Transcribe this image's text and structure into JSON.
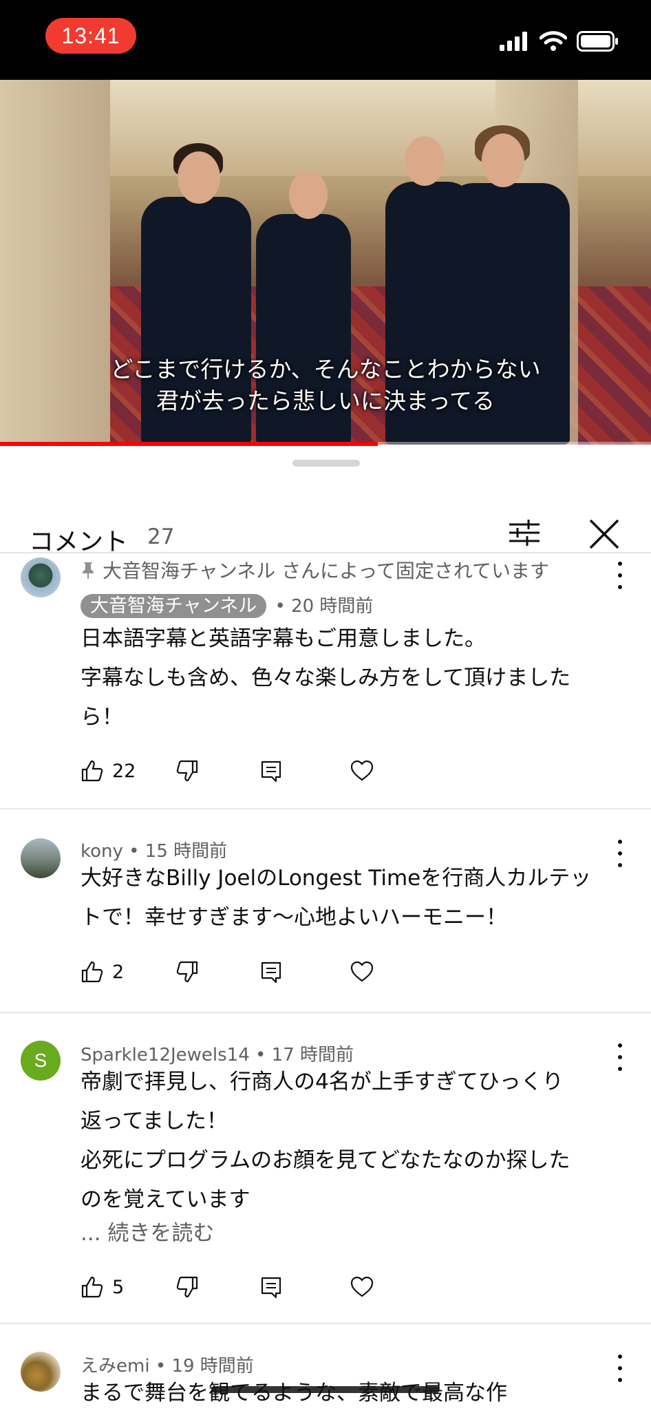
{
  "status_bar": {
    "time": "13:41"
  },
  "video": {
    "subtitle_line1": "どこまで行けるか、そんなことわからない",
    "subtitle_line2": "君が去ったら悲しいに決まってる",
    "progress": 0.58
  },
  "comments_panel": {
    "title": "コメント",
    "count": "27",
    "comments": [
      {
        "pinned_text": "大音智海チャンネル さんによって固定されています",
        "author": "大音智海チャンネル",
        "time": "• 20 時間前",
        "lines": [
          "日本語字幕と英語字幕もご用意しました。",
          "字幕なしも含め、色々な楽しみ方をして頂けました",
          "ら！"
        ],
        "likes": "22"
      },
      {
        "author": "kony",
        "time": "• 15 時間前",
        "lines": [
          "大好きなBilly JoelのLongest Timeを行商人カルテッ",
          "トで！幸せすぎます〜心地よいハーモニー！"
        ],
        "likes": "2"
      },
      {
        "author": "Sparkle12Jewels14",
        "time": "• 17 時間前",
        "avatar_letter": "S",
        "lines": [
          "帝劇で拝見し、行商人の4名が上手すぎてひっくり",
          "返ってました！",
          "必死にプログラムのお顔を見てどなたなのか探した",
          "のを覚えています"
        ],
        "read_more": "... 続きを読む",
        "likes": "5"
      },
      {
        "author": "えみemi",
        "time": "• 19 時間前",
        "lines": [
          "まるで舞台を観てるような、素敵で最高な作"
        ]
      }
    ]
  },
  "colors": {
    "accent_red": "#ff0000",
    "time_pill": "#f23b30",
    "avatar_green": "#6aaa1e",
    "secondary_text": "#606060"
  }
}
